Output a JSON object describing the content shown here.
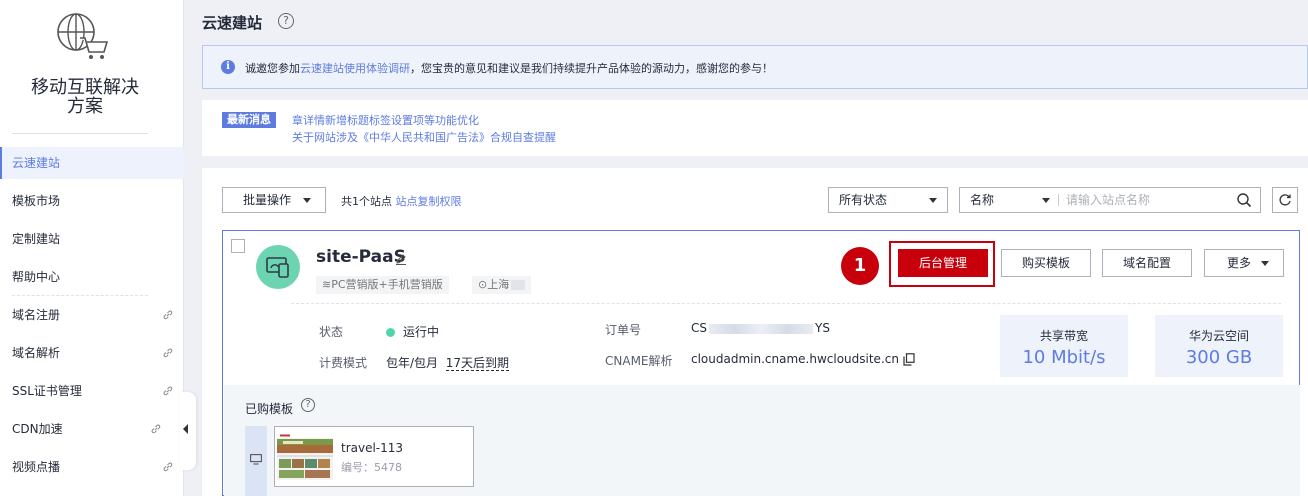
{
  "sidebar": {
    "product_name_line1": "移动互联解决",
    "product_name_line2": "方案",
    "items": [
      {
        "label": "云速建站",
        "active": true,
        "external": false
      },
      {
        "label": "模板市场",
        "external": false
      },
      {
        "label": "定制建站",
        "external": false
      },
      {
        "label": "帮助中心",
        "external": false
      },
      {
        "label": "域名注册",
        "external": true
      },
      {
        "label": "域名解析",
        "external": true
      },
      {
        "label": "SSL证书管理",
        "external": true
      },
      {
        "label": "CDN加速",
        "external": true
      },
      {
        "label": "视频点播",
        "external": true
      }
    ]
  },
  "header": {
    "title": "云速建站",
    "help_icon": "?"
  },
  "notice": {
    "prefix": "诚邀您参加",
    "link": "云速建站使用体验调研",
    "suffix": "，您宝贵的意见和建议是我们持续提升产品体验的源动力，感谢您的参与！"
  },
  "news": {
    "badge": "最新消息",
    "line1": "章详情新增标题标签设置项等功能优化",
    "line2": "关于网站涉及《中华人民共和国广告法》合规自查提醒"
  },
  "toolbar": {
    "batch_label": "批量操作",
    "site_count": "共1个站点",
    "copy_permission_link": "站点复制权限",
    "status_select": "所有状态",
    "search_field": "名称",
    "search_placeholder": "请输入站点名称"
  },
  "site": {
    "name": "site-PaaS",
    "tag_edition": "PC营销版+手机营销版",
    "tag_region": "上海",
    "step_number": "1",
    "btn_admin": "后台管理",
    "btn_buy_template": "购买模板",
    "btn_domain_config": "域名配置",
    "btn_more": "更多",
    "status_label": "状态",
    "status_value": "运行中",
    "billing_label": "计费模式",
    "billing_value": "包年/包月",
    "expire_value": "17天后到期",
    "order_label": "订单号",
    "order_prefix": "CS",
    "order_suffix": "YS",
    "cname_label": "CNAME解析",
    "cname_value": "cloudadmin.cname.hwcloudsite.cn",
    "bandwidth_label": "共享带宽",
    "bandwidth_value": "10 Mbit/s",
    "space_label": "华为云空间",
    "space_value": "300 GB"
  },
  "templates": {
    "title": "已购模板",
    "items": [
      {
        "name": "travel-113",
        "number_label": "编号：5478"
      }
    ]
  },
  "colors": {
    "brand": "#5e7ce0",
    "primary_action": "#c7000b",
    "running_status": "#50d4ab"
  }
}
